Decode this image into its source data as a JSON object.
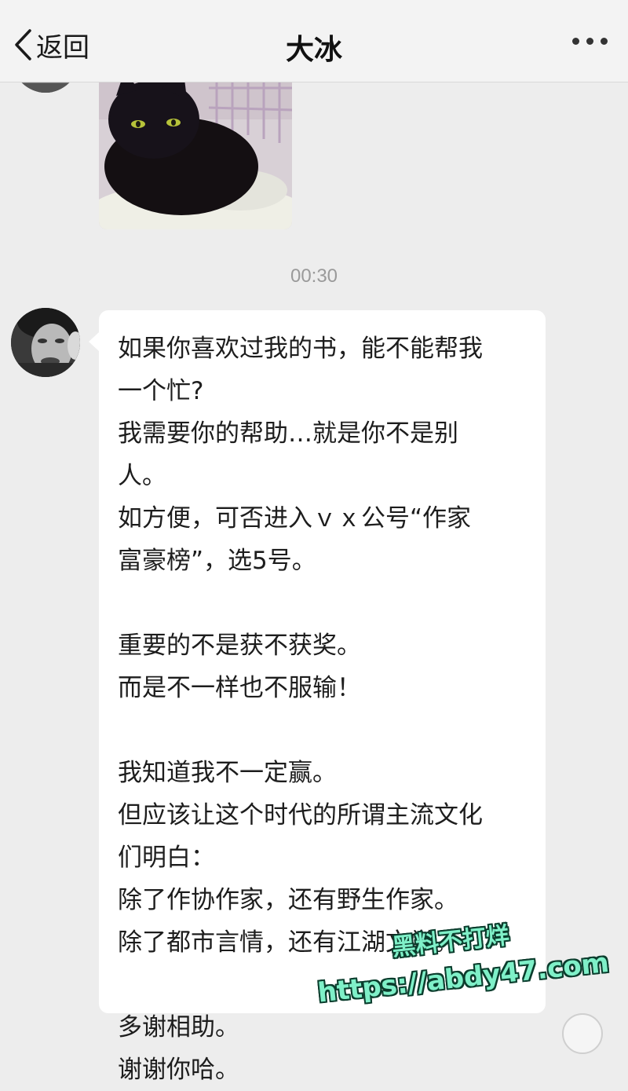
{
  "nav": {
    "back_label": "返回",
    "title": "大冰",
    "more_icon": "more-dots-icon"
  },
  "photo_message": {
    "description_icon": "cat-photo-image"
  },
  "timestamp": "00:30",
  "message": {
    "lines": [
      "如果你喜欢过我的书，能不能帮我",
      "一个忙?",
      " 我需要你的帮助…就是你不是别",
      "人。",
      "如方便，可否进入ｖｘ公号“作家",
      "富豪榜”，选5号。",
      "",
      "重要的不是获不获奖。",
      "而是不一样也不服输！",
      "",
      "我知道我不一定赢。",
      "但应该让这个时代的所谓主流文化",
      "们明白：",
      "除了作协作家，还有野生作家。",
      "除了都市言情，还有江湖文学。",
      "",
      "多谢相助。",
      "谢谢你哈。"
    ]
  },
  "watermark": {
    "line1": "黑料不打烊",
    "line2": "https://abdy47.com"
  },
  "colors": {
    "background": "#ededed",
    "bubble": "#ffffff",
    "nav": "#f3f3f3",
    "watermark": "#7ff0c8"
  }
}
